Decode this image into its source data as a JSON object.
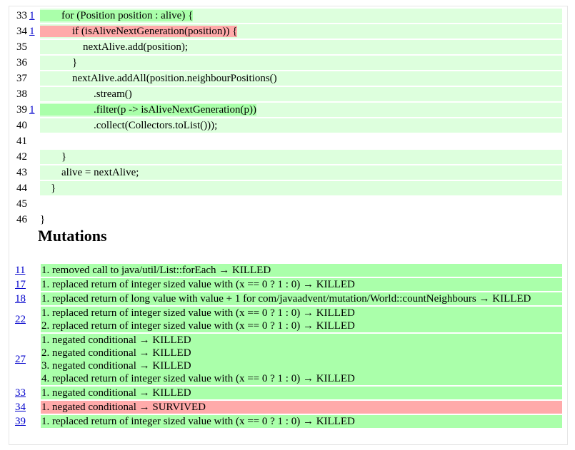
{
  "source_lines": [
    {
      "num": "33",
      "mut_link": "1",
      "text": "        for (Position position : alive) {",
      "style": "killed"
    },
    {
      "num": "34",
      "mut_link": "1",
      "text": "            if (isAliveNextGeneration(position)) {",
      "style": "survived"
    },
    {
      "num": "35",
      "mut_link": "",
      "text": "                nextAlive.add(position);",
      "style": "covered"
    },
    {
      "num": "36",
      "mut_link": "",
      "text": "            }",
      "style": "covered"
    },
    {
      "num": "37",
      "mut_link": "",
      "text": "            nextAlive.addAll(position.neighbourPositions()",
      "style": "covered"
    },
    {
      "num": "38",
      "mut_link": "",
      "text": "                    .stream()",
      "style": "covered"
    },
    {
      "num": "39",
      "mut_link": "1",
      "text": "                    .filter(p -> isAliveNextGeneration(p))",
      "style": "killed"
    },
    {
      "num": "40",
      "mut_link": "",
      "text": "                    .collect(Collectors.toList()));",
      "style": "covered"
    },
    {
      "num": "41",
      "mut_link": "",
      "text": "",
      "style": "none"
    },
    {
      "num": "42",
      "mut_link": "",
      "text": "        }",
      "style": "covered"
    },
    {
      "num": "43",
      "mut_link": "",
      "text": "        alive = nextAlive;",
      "style": "covered"
    },
    {
      "num": "44",
      "mut_link": "",
      "text": "    }",
      "style": "covered"
    },
    {
      "num": "45",
      "mut_link": "",
      "text": "",
      "style": "none"
    },
    {
      "num": "46",
      "mut_link": "",
      "text": "}",
      "style": "none"
    }
  ],
  "mutations_title": "Mutations",
  "mutations": [
    {
      "line": "11",
      "status": "killed",
      "items": [
        "1. removed call to java/util/List::forEach → KILLED"
      ]
    },
    {
      "line": "17",
      "status": "killed",
      "items": [
        "1. replaced return of integer sized value with (x == 0 ? 1 : 0) → KILLED"
      ]
    },
    {
      "line": "18",
      "status": "killed",
      "items": [
        "1. replaced return of long value with value + 1 for com/javaadvent/mutation/World::countNeighbours → KILLED"
      ]
    },
    {
      "line": "22",
      "status": "killed",
      "items": [
        "1. replaced return of integer sized value with (x == 0 ? 1 : 0) → KILLED",
        "2. replaced return of integer sized value with (x == 0 ? 1 : 0) → KILLED"
      ]
    },
    {
      "line": "27",
      "status": "killed",
      "items": [
        "1. negated conditional → KILLED",
        "2. negated conditional → KILLED",
        "3. negated conditional → KILLED",
        "4. replaced return of integer sized value with (x == 0 ? 1 : 0) → KILLED"
      ]
    },
    {
      "line": "33",
      "status": "killed",
      "items": [
        "1. negated conditional → KILLED"
      ]
    },
    {
      "line": "34",
      "status": "survived",
      "items": [
        "1. negated conditional → SURVIVED"
      ]
    },
    {
      "line": "39",
      "status": "killed",
      "items": [
        "1. replaced return of integer sized value with (x == 0 ? 1 : 0) → KILLED"
      ]
    }
  ],
  "colors": {
    "covered": "#ddffdd",
    "killed": "#aaffaa",
    "survived": "#ffaaaa",
    "link": "#0000cc"
  }
}
